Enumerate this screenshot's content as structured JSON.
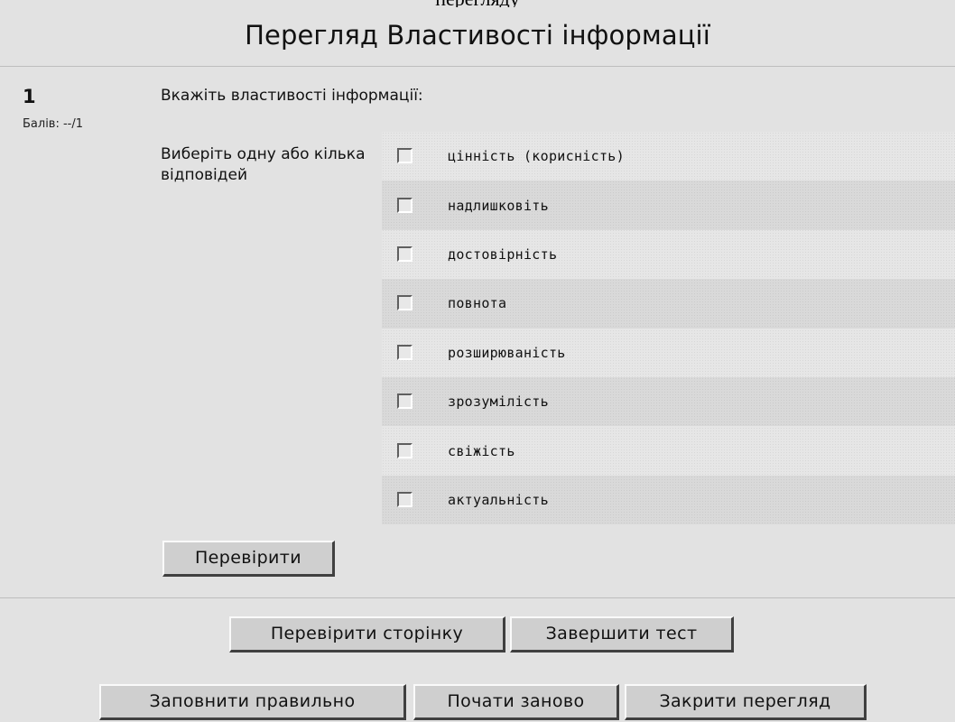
{
  "header": {
    "caption_fragment": "перегляду",
    "title": "Перегляд Властивості інформації"
  },
  "question": {
    "number": "1",
    "score": "Балів: --/1",
    "text": "Вкажіть властивості інформації:",
    "prompt": "Виберіть одну або кілька відповідей",
    "options": [
      {
        "label": "цінність (корисність)",
        "checked": false
      },
      {
        "label": "надлишковіть",
        "checked": false
      },
      {
        "label": "достовірність",
        "checked": false
      },
      {
        "label": "повнота",
        "checked": false
      },
      {
        "label": "розширюваність",
        "checked": false
      },
      {
        "label": "зрозумілість",
        "checked": false
      },
      {
        "label": "свіжість",
        "checked": false
      },
      {
        "label": "актуальність",
        "checked": false
      }
    ],
    "check_button": "Перевірити"
  },
  "footer": {
    "check_page_button": "Перевірити сторінку",
    "finish_button": "Завершити тест",
    "fill_correct_button": "Заповнити правильно",
    "restart_button": "Почати заново",
    "close_preview_button": "Закрити перегляд"
  },
  "colors": {
    "background": "#e2e2e2",
    "button_face": "#cfcfcf",
    "row_alt": "#d9d9d9"
  }
}
